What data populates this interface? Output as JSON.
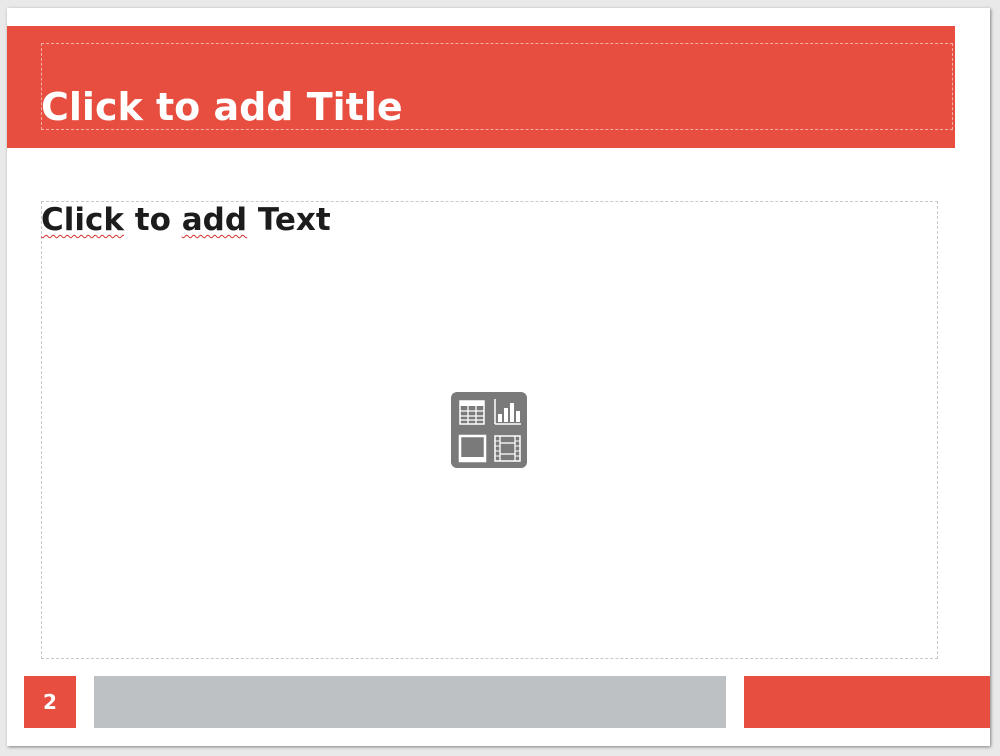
{
  "slide": {
    "title_placeholder": "Click to add Title",
    "body_placeholder_words": [
      "Click",
      "to",
      "add",
      "Text"
    ],
    "slide_number": "2"
  },
  "insert_toolbar": {
    "items": [
      {
        "name": "table-icon"
      },
      {
        "name": "chart-icon"
      },
      {
        "name": "image-icon"
      },
      {
        "name": "video-icon"
      }
    ]
  },
  "colors": {
    "accent": "#e84e40",
    "footer_gray": "#bdc1c4",
    "toolbar_gray": "#7a7a7a"
  }
}
